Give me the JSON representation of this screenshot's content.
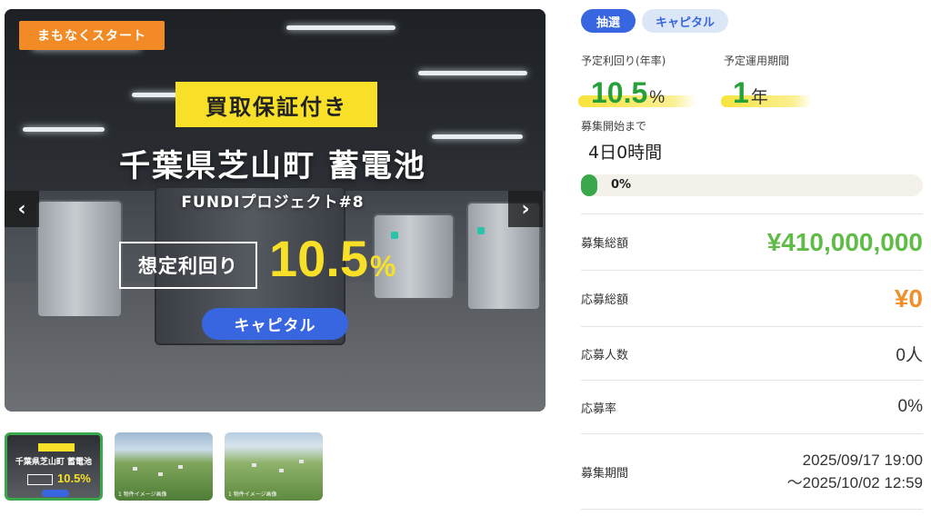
{
  "hero": {
    "badge": "まもなくスタート",
    "guarantee": "買取保証付き",
    "title": "千葉県芝山町 蓄電池",
    "subtitle": "FUNDIプロジェクト#8",
    "yield_label": "想定利回り",
    "yield_value": "10.5",
    "yield_unit": "%",
    "category_pill": "キャピタル",
    "prev_arrow": "‹",
    "next_arrow": "›"
  },
  "thumbnails": [
    {
      "guarantee": "買取保証付き",
      "title": "千葉県芝山町 蓄電池",
      "yield": "10.5%",
      "pill": "キャピタル",
      "selected": true
    },
    {
      "caption": "1 物件イメージ画像",
      "selected": false
    },
    {
      "caption": "1 物件イメージ画像",
      "selected": false
    }
  ],
  "tags": {
    "lottery": "抽選",
    "capital": "キャピタル"
  },
  "summary": {
    "yield_label": "予定利回り(年率)",
    "yield_value": "10.5",
    "yield_unit": "%",
    "period_label": "予定運用期間",
    "period_value": "1",
    "period_unit": "年",
    "countdown_label": "募集開始まで",
    "countdown_value": "4日0時間"
  },
  "progress": {
    "value_text": "0%",
    "fraction": 0.0
  },
  "rows": [
    {
      "label": "募集総額",
      "value": "¥410,000,000"
    },
    {
      "label": "応募総額",
      "value": "¥0"
    },
    {
      "label": "応募人数",
      "value": "0人"
    },
    {
      "label": "応募率",
      "value": "0%"
    },
    {
      "label": "募集期間",
      "value_line1": "2025/09/17 19:00",
      "value_line2": "～2025/10/02 12:59"
    }
  ],
  "colors": {
    "badge": "#f28a25",
    "highlight_yellow": "#f7e027",
    "brand_blue": "#3866e0",
    "yield_green": "#27a03a",
    "amount_green": "#5fbc46",
    "amount_orange": "#f0902a"
  }
}
